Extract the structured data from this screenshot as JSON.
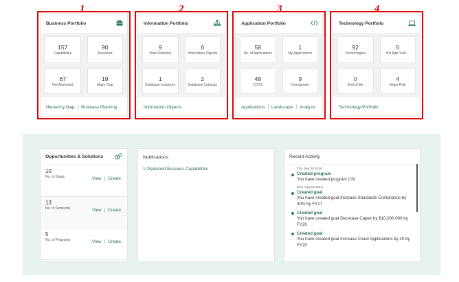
{
  "annotations": [
    "1",
    "2",
    "3",
    "4"
  ],
  "portfolios": [
    {
      "title": "Business Portfolio",
      "icon": "briefcase-icon",
      "metrics": [
        {
          "value": "157",
          "label": "Capabilities"
        },
        {
          "value": "90",
          "label": "Assessed"
        },
        {
          "value": "67",
          "label": "Not Assessed"
        },
        {
          "value": "19",
          "label": "Major Gap"
        }
      ],
      "links": [
        "Hierarchy Map",
        "Business Planning"
      ]
    },
    {
      "title": "Information Portfolio",
      "icon": "hierarchy-icon",
      "metrics": [
        {
          "value": "9",
          "label": "Data Domains"
        },
        {
          "value": "6",
          "label": "Information Objects"
        },
        {
          "value": "1",
          "label": "Database Instances"
        },
        {
          "value": "2",
          "label": "Database Catalogs"
        }
      ],
      "links": [
        "Information Objects"
      ]
    },
    {
      "title": "Application Portfolio",
      "icon": "code-icon",
      "metrics": [
        {
          "value": "58",
          "label": "No. of Applications"
        },
        {
          "value": "1",
          "label": "My Applications"
        },
        {
          "value": "48",
          "label": "COTS"
        },
        {
          "value": "9",
          "label": "Homegrown"
        }
      ],
      "links": [
        "Applications",
        "Landscape",
        "Analyze"
      ]
    },
    {
      "title": "Technology Portfolio",
      "icon": "laptop-icon",
      "metrics": [
        {
          "value": "92",
          "label": "Technologies"
        },
        {
          "value": "5",
          "label": "Biz App Tech..."
        },
        {
          "value": "0",
          "label": "End of life"
        },
        {
          "value": "4",
          "label": "Major Risk"
        }
      ],
      "links": [
        "Technology Portfolio"
      ]
    }
  ],
  "opportunities": {
    "title": "Opportunities & Solutions",
    "view_label": "View",
    "create_label": "Create",
    "rows": [
      {
        "value": "10",
        "label": "No. of Goals"
      },
      {
        "value": "13",
        "label": "No. of Demands"
      },
      {
        "value": "5",
        "label": "No. of Programs"
      }
    ]
  },
  "notifications": {
    "title": "Notifications",
    "items": [
      "1 Orphaned Business Capabilities"
    ]
  },
  "activity": {
    "title": "Recent Activity",
    "items": [
      {
        "date": "Thu Sep 05 2019",
        "title": "Created program",
        "desc": "You have created program CSI"
      },
      {
        "date": "Mon Aug 26 2019",
        "title": "Created goal",
        "desc": "You have created goal Increase Standards Compliance by 30% by FY17"
      },
      {
        "date": "",
        "title": "Created goal",
        "desc": "You have created goal Decrease Capex by $10,000,000 by FY20"
      },
      {
        "date": "",
        "title": "Created goal",
        "desc": "You have created goal Increase Cloud Applications by 20 by FY20"
      }
    ]
  },
  "colors": {
    "accent": "#2e7d62",
    "highlight": "#e10000",
    "background_band": "#e8f2ef"
  }
}
